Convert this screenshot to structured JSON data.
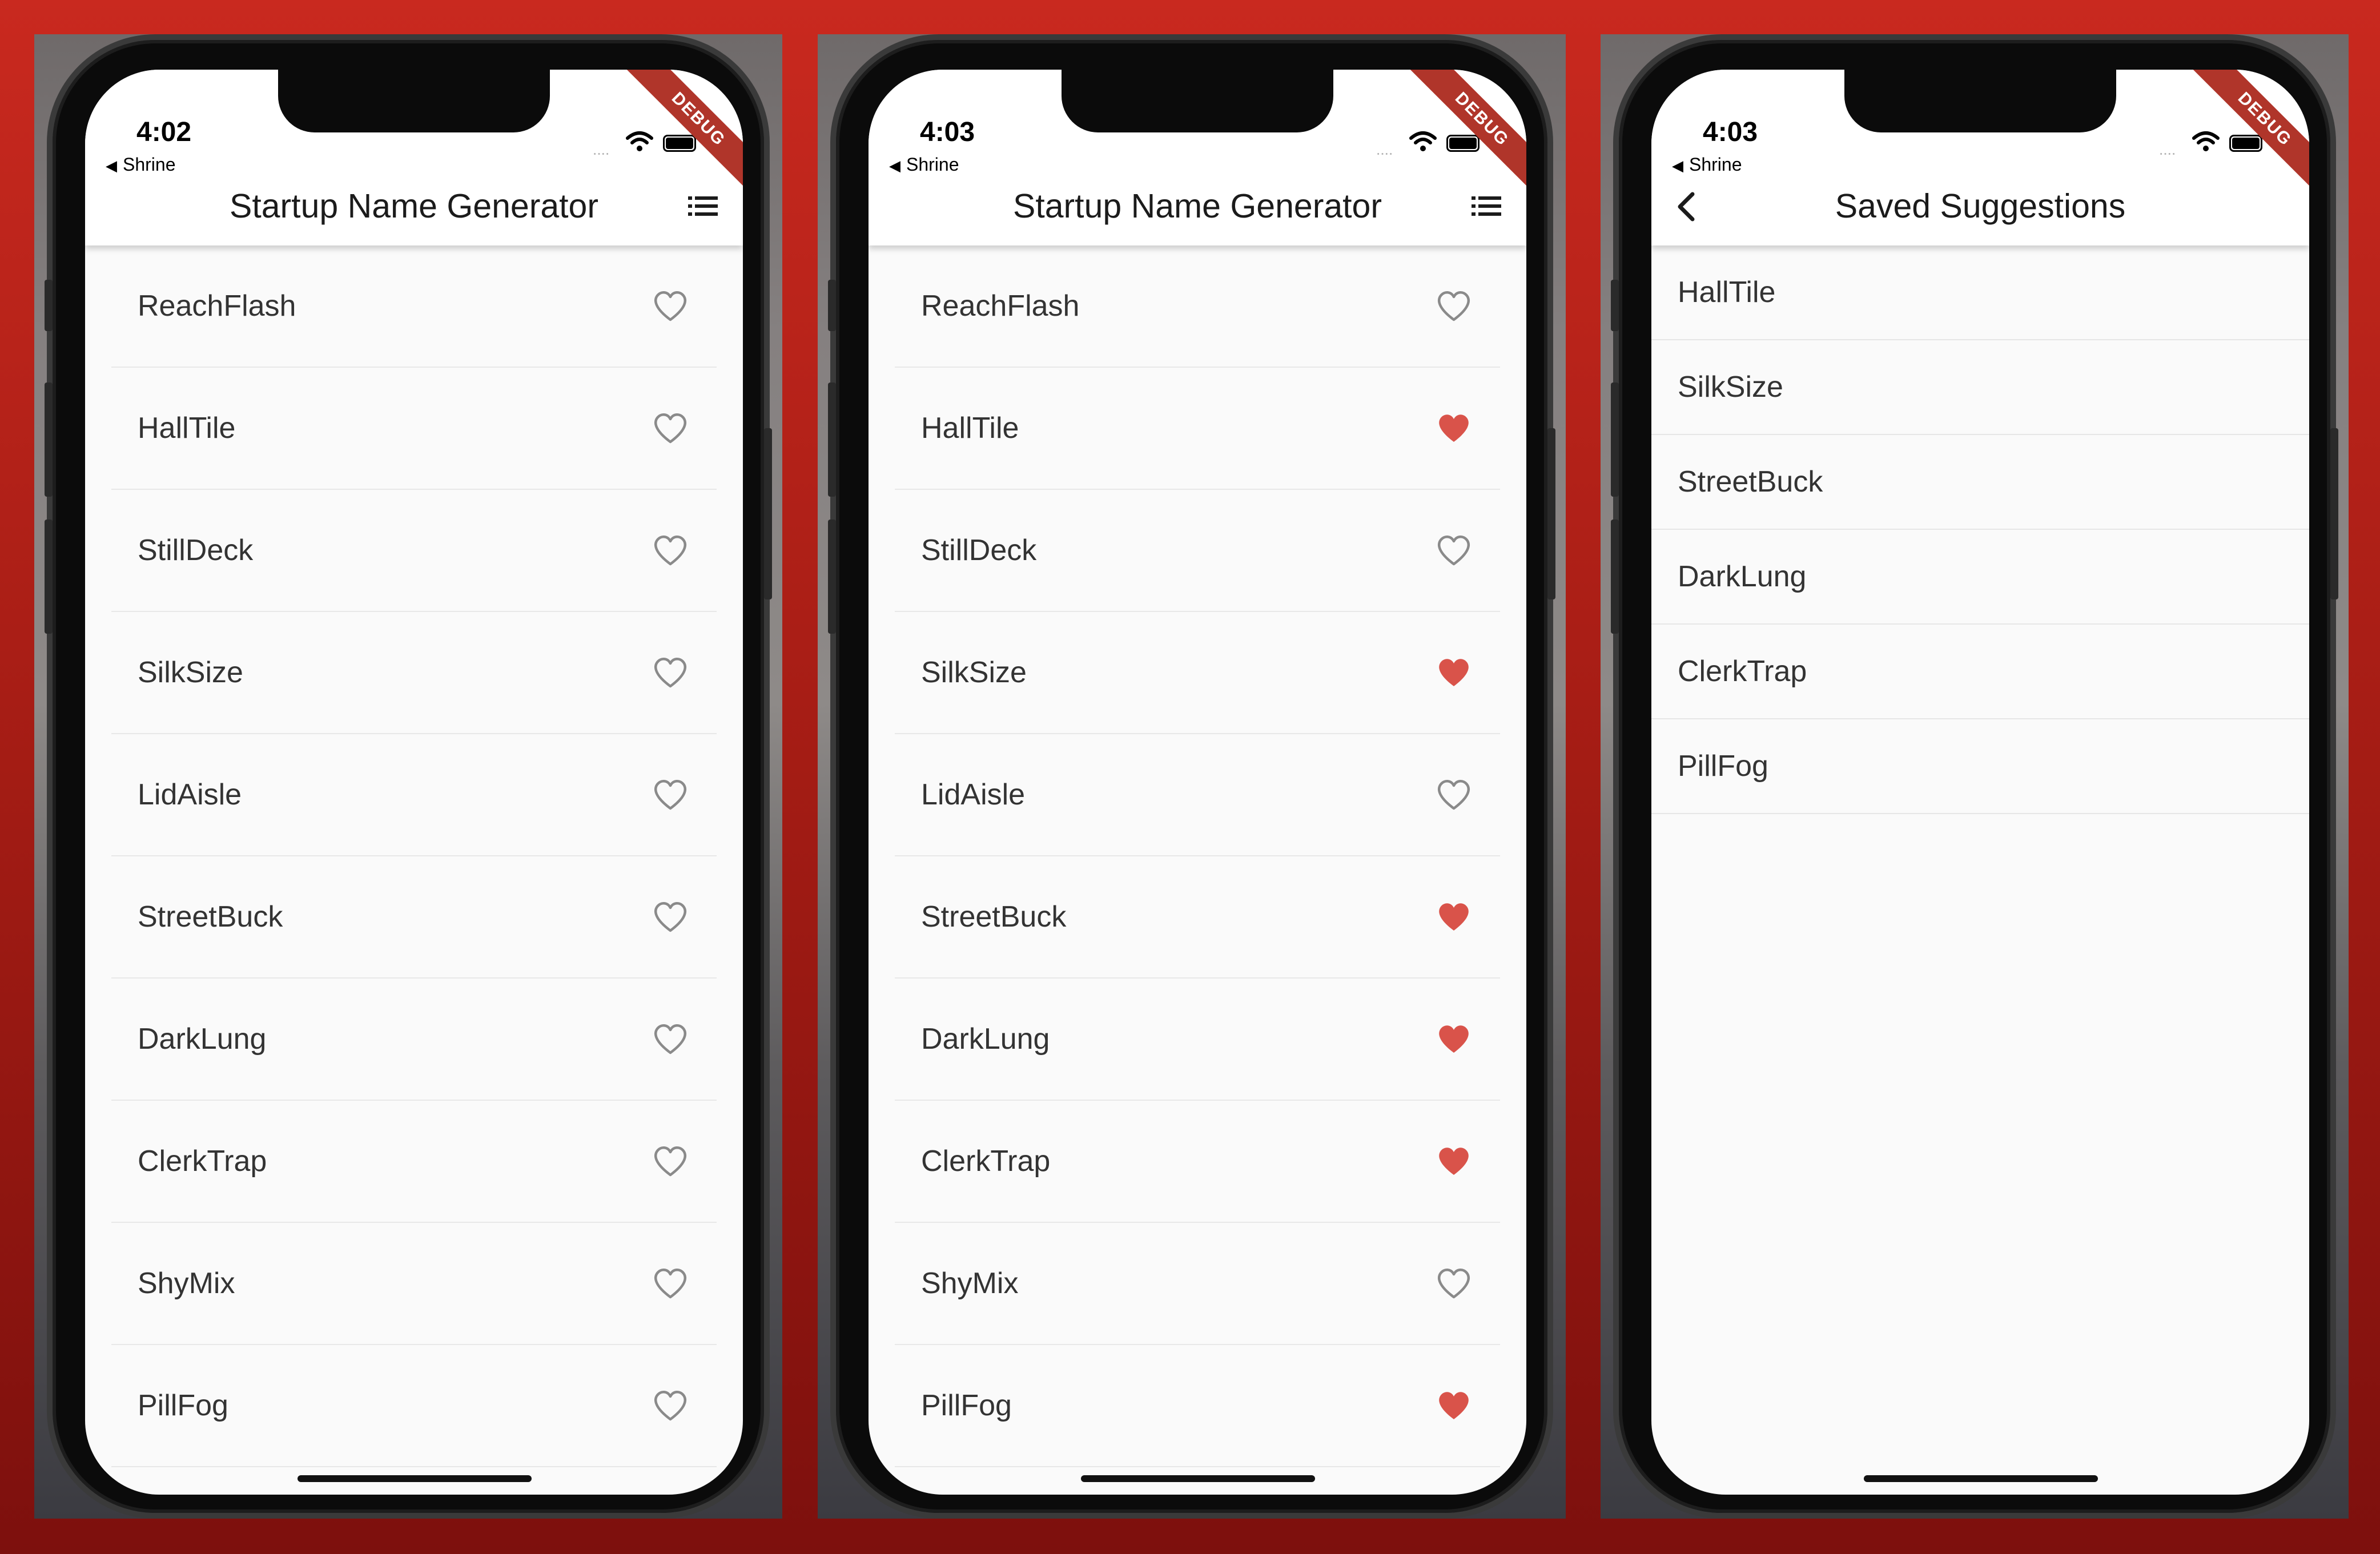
{
  "phones": [
    {
      "time": "4:02",
      "back_app": "Shrine",
      "debug_banner": "DEBUG",
      "title": "Startup Name Generator",
      "items": [
        {
          "name": "ReachFlash",
          "saved": false
        },
        {
          "name": "HallTile",
          "saved": false
        },
        {
          "name": "StillDeck",
          "saved": false
        },
        {
          "name": "SilkSize",
          "saved": false
        },
        {
          "name": "LidAisle",
          "saved": false
        },
        {
          "name": "StreetBuck",
          "saved": false
        },
        {
          "name": "DarkLung",
          "saved": false
        },
        {
          "name": "ClerkTrap",
          "saved": false
        },
        {
          "name": "ShyMix",
          "saved": false
        },
        {
          "name": "PillFog",
          "saved": false
        }
      ]
    },
    {
      "time": "4:03",
      "back_app": "Shrine",
      "debug_banner": "DEBUG",
      "title": "Startup Name Generator",
      "items": [
        {
          "name": "ReachFlash",
          "saved": false
        },
        {
          "name": "HallTile",
          "saved": true
        },
        {
          "name": "StillDeck",
          "saved": false
        },
        {
          "name": "SilkSize",
          "saved": true
        },
        {
          "name": "LidAisle",
          "saved": false
        },
        {
          "name": "StreetBuck",
          "saved": true
        },
        {
          "name": "DarkLung",
          "saved": true
        },
        {
          "name": "ClerkTrap",
          "saved": true
        },
        {
          "name": "ShyMix",
          "saved": false
        },
        {
          "name": "PillFog",
          "saved": true
        }
      ]
    },
    {
      "time": "4:03",
      "back_app": "Shrine",
      "debug_banner": "DEBUG",
      "title": "Saved Suggestions",
      "items": [
        {
          "name": "HallTile"
        },
        {
          "name": "SilkSize"
        },
        {
          "name": "StreetBuck"
        },
        {
          "name": "DarkLung"
        },
        {
          "name": "ClerkTrap"
        },
        {
          "name": "PillFog"
        }
      ]
    }
  ],
  "icons": {
    "list_action": "list-icon",
    "back_action": "chevron-left-icon",
    "favorite_filled": "heart-filled-icon",
    "favorite_outline": "heart-outline-icon"
  },
  "colors": {
    "heart_saved": "#d9534a",
    "heart_unsaved": "#8a8a8a",
    "debug_banner": "#b0352a",
    "background": "#c9291f"
  }
}
